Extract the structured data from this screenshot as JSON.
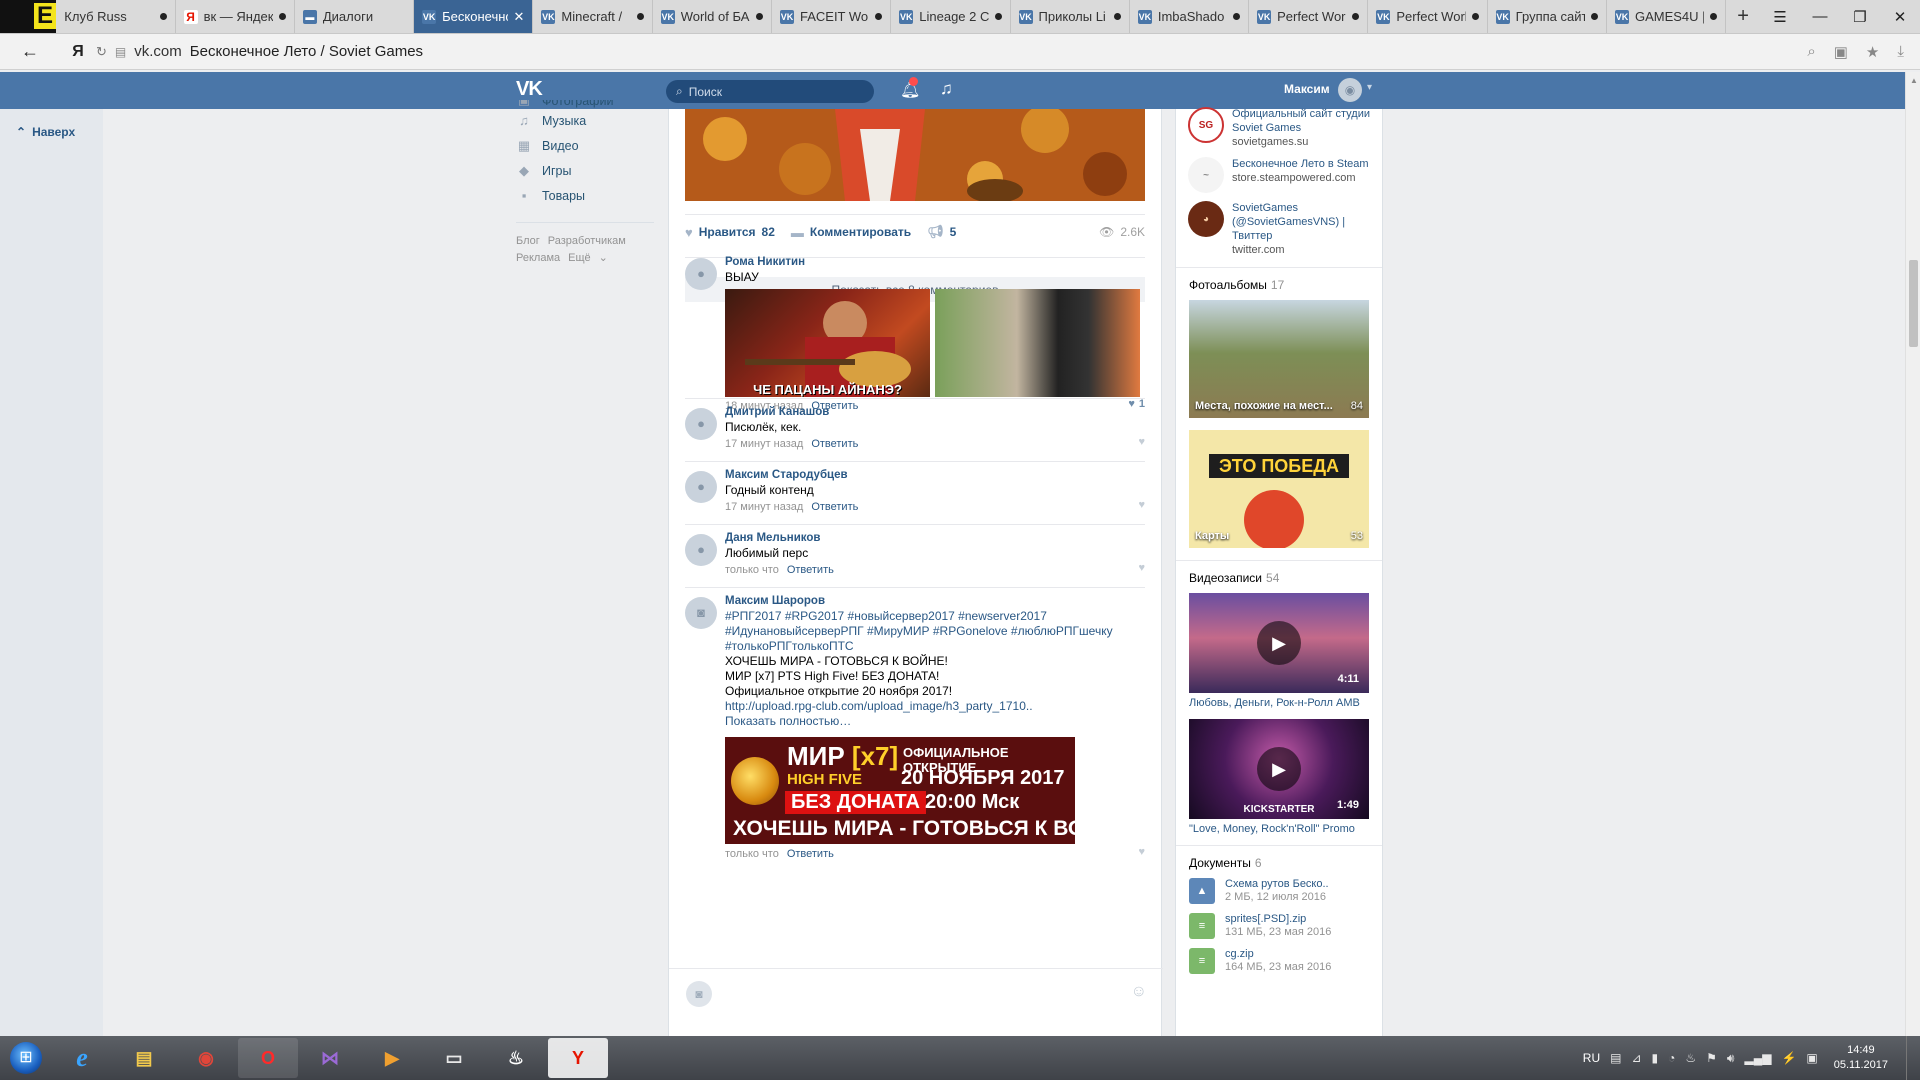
{
  "browser": {
    "tabs": [
      {
        "label": "Клуб Russ",
        "icon": "stalker-e-icon"
      },
      {
        "label": "вк — Яндекс",
        "icon": "yandex-icon"
      },
      {
        "label": "Диалоги",
        "icon": "chat-icon"
      },
      {
        "label": "Бесконечно",
        "icon": "vk-icon",
        "active": true
      },
      {
        "label": "Minecraft / ",
        "icon": "vk-icon"
      },
      {
        "label": "World of БА",
        "icon": "vk-icon"
      },
      {
        "label": "FACEIT Worl",
        "icon": "vk-icon"
      },
      {
        "label": "Lineage 2 Cl",
        "icon": "vk-icon"
      },
      {
        "label": "Приколы Li",
        "icon": "vk-icon"
      },
      {
        "label": "ImbaShado",
        "icon": "vk-icon"
      },
      {
        "label": "Perfect Worl",
        "icon": "vk-icon"
      },
      {
        "label": "Perfect Worl",
        "icon": "vk-icon"
      },
      {
        "label": "Группа сайт",
        "icon": "vk-icon"
      },
      {
        "label": "GAMES4U |",
        "icon": "vk-icon"
      }
    ],
    "new_tab": "+",
    "address": {
      "domain": "vk.com",
      "title": "Бесконечное Лето / Soviet Games"
    }
  },
  "vk_header": {
    "logo": "VK",
    "search_placeholder": "Поиск",
    "user_name": "Максим"
  },
  "left_strip": {
    "back_to_top": "Наверх"
  },
  "left_menu": {
    "items": [
      {
        "label": "Фотографии",
        "icon": "photo-icon"
      },
      {
        "label": "Музыка",
        "icon": "music-icon"
      },
      {
        "label": "Видео",
        "icon": "video-icon"
      },
      {
        "label": "Игры",
        "icon": "games-icon"
      },
      {
        "label": "Товары",
        "icon": "goods-icon"
      }
    ],
    "footer": [
      "Блог",
      "Разработчикам",
      "Реклама",
      "Ещё"
    ]
  },
  "post": {
    "likes_label": "Нравится",
    "likes_count": "82",
    "comment_label": "Комментировать",
    "shares_count": "5",
    "views": "2.6K",
    "show_all_comments": "Показать все 8 комментариев"
  },
  "comments": [
    {
      "author": "Рома Никитин",
      "text": "ВЫАУ",
      "photo_caption": "ЧЕ ПАЦАНЫ АЙНАНЭ?",
      "time": "18 минут назад",
      "reply": "Ответить",
      "likes": "1"
    },
    {
      "author": "Дмитрий Канашов",
      "text": "Писюлёк, кек.",
      "time": "17 минут назад",
      "reply": "Ответить"
    },
    {
      "author": "Максим Стародубцев",
      "text": "Годный контенд",
      "time": "17 минут назад",
      "reply": "Ответить"
    },
    {
      "author": "Даня Мельников",
      "text": "Любимый перс",
      "time": "только что",
      "reply": "Ответить"
    },
    {
      "author": "Максим Шароров",
      "hashtags_1": "#РПГ2017 #RPG2017 #новыйсервер2017 #newserver2017",
      "hashtags_2": "#ИдунановыйсерверРПГ #МируМИР #RPGonelove #люблюРПГшечку",
      "hashtags_3": "#толькоРПГтолькоПТС",
      "line_1": "ХОЧЕШЬ МИРА - ГОТОВЬСЯ К ВОЙНЕ!",
      "line_2": "МИР [x7] PTS High Five! БЕЗ ДОНАТА!",
      "line_3": "Официальное открытие 20 ноября 2017!",
      "link": "http://upload.rpg-club.com/upload_image/h3_party_1710..",
      "show_more": "Показать полностью…",
      "banner": {
        "mir": "МИР",
        "x7": "[x7]",
        "official": "ОФИЦИАЛЬНОЕ ОТКРЫТИЕ",
        "high_five": "HIGH FIVE",
        "date": "20 НОЯБРЯ 2017",
        "no_donate": "БЕЗ ДОНАТА",
        "time": "20:00 Мск",
        "slogan": "ХОЧЕШЬ МИРА - ГОТОВЬСЯ К ВОЙНЕ"
      },
      "time": "только что",
      "reply": "Ответить"
    }
  ],
  "right_col": {
    "links": [
      {
        "title": "Официальный сайт студии Soviet Games",
        "url": "sovietgames.su"
      },
      {
        "title": "Бесконечное Лето в Steam",
        "url": "store.steampowered.com"
      },
      {
        "title": "SovietGames (@SovietGamesVNS) | Твиттер",
        "url": "twitter.com"
      }
    ],
    "albums_header": "Фотоальбомы",
    "albums_count": "17",
    "albums": [
      {
        "title": "Места, похожие на мест...",
        "count": "84"
      },
      {
        "title": "Карты",
        "count": "53",
        "banner": "ЭТО ПОБЕДА"
      }
    ],
    "videos_header": "Видеозаписи",
    "videos_count": "54",
    "videos": [
      {
        "title": "Любовь, Деньги, Рок-н-Ролл AMB",
        "duration": "4:11"
      },
      {
        "title": "\"Love, Money, Rock'n'Roll\" Promo",
        "duration": "1:49",
        "overlay": "KICKSTARTER"
      }
    ],
    "docs_header": "Документы",
    "docs_count": "6",
    "docs": [
      {
        "name": "Схема рутов Беско..",
        "meta": "2 МБ, 12 июля 2016"
      },
      {
        "name": "sprites[.PSD].zip",
        "meta": "131 МБ, 23 мая 2016"
      },
      {
        "name": "cg.zip",
        "meta": "164 МБ, 23 мая 2016"
      }
    ]
  },
  "taskbar": {
    "apps": [
      {
        "name": "internet-explorer",
        "glyph": "e"
      },
      {
        "name": "file-explorer",
        "glyph": "▤"
      },
      {
        "name": "chrome",
        "glyph": "◉"
      },
      {
        "name": "opera",
        "glyph": "O"
      },
      {
        "name": "visual-studio",
        "glyph": "⋈"
      },
      {
        "name": "media-player",
        "glyph": "▶"
      },
      {
        "name": "command-prompt",
        "glyph": "▭"
      },
      {
        "name": "steam",
        "glyph": "♨"
      },
      {
        "name": "yandex-browser",
        "glyph": "Y"
      }
    ],
    "lang": "RU",
    "time": "14:49",
    "date": "05.11.2017"
  }
}
